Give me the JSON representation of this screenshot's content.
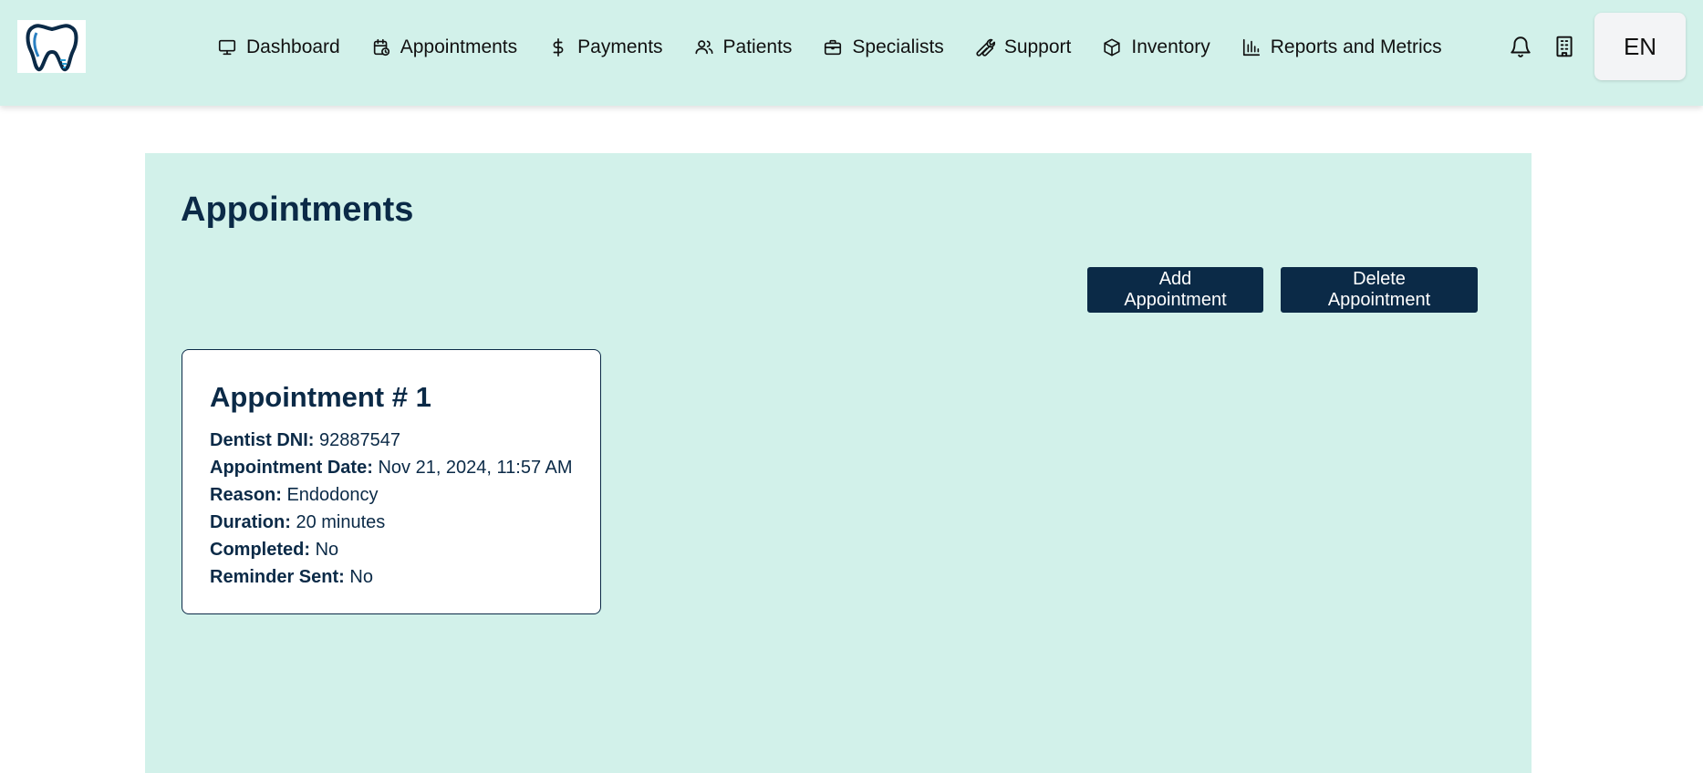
{
  "app": {
    "logo_name": "tooth-logo"
  },
  "nav": {
    "items": [
      {
        "label": "Dashboard",
        "icon": "monitor-icon"
      },
      {
        "label": "Appointments",
        "icon": "calendar-clock-icon"
      },
      {
        "label": "Payments",
        "icon": "dollar-icon"
      },
      {
        "label": "Patients",
        "icon": "users-icon"
      },
      {
        "label": "Specialists",
        "icon": "briefcase-icon"
      },
      {
        "label": "Support",
        "icon": "wrench-icon"
      },
      {
        "label": "Inventory",
        "icon": "box-icon"
      },
      {
        "label": "Reports and Metrics",
        "icon": "bar-chart-icon"
      }
    ]
  },
  "header_actions": {
    "notifications_icon": "bell-icon",
    "clinic_icon": "building-icon",
    "language": "EN"
  },
  "page": {
    "title": "Appointments",
    "add_button": "Add Appointment",
    "delete_button": "Delete Appointment"
  },
  "appointments": [
    {
      "title": "Appointment # 1",
      "fields": [
        {
          "label": "Dentist DNI:",
          "value": "92887547"
        },
        {
          "label": "Appointment Date:",
          "value": "Nov 21, 2024, 11:57 AM"
        },
        {
          "label": "Reason:",
          "value": "Endodoncy"
        },
        {
          "label": "Duration:",
          "value": "20 minutes"
        },
        {
          "label": "Completed:",
          "value": "No"
        },
        {
          "label": "Reminder Sent:",
          "value": "No"
        }
      ]
    }
  ],
  "colors": {
    "header_bg": "#d2f1ea",
    "primary": "#0b2a47",
    "card_bg": "#ffffff",
    "lang_bg": "#f3f4f6"
  }
}
